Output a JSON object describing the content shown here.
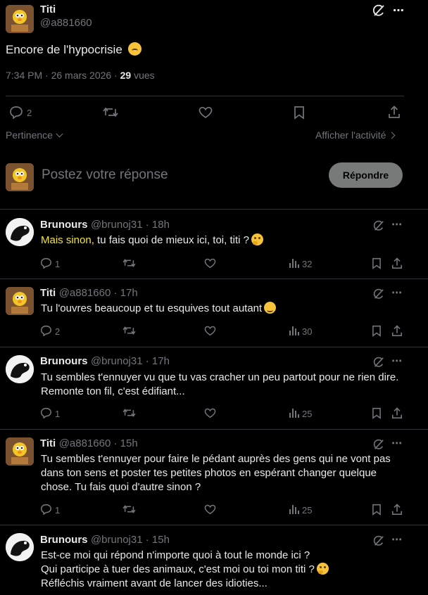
{
  "main_post": {
    "author_name": "Titi",
    "author_handle": "@a881660",
    "text": "Encore de l'hypocrisie",
    "timestamp": "7:34 PM · 26 mars 2026 · ",
    "views_count": "29",
    "views_label": " vues",
    "reply_count": "2"
  },
  "sort": {
    "label": "Pertinence",
    "activity_label": "Afficher l'activité"
  },
  "composer": {
    "placeholder": "Postez votre réponse",
    "button_label": "Répondre"
  },
  "replies": [
    {
      "author_name": "Brunours",
      "author_handle": "@brunoj31 · 18h",
      "text_highlight": "Mais sinon,",
      "text": " tu fais quoi de mieux ici, toi, titi ?",
      "replies": "1",
      "views": "32"
    },
    {
      "author_name": "Titi",
      "author_handle": "@a881660 · 17h",
      "text": "Tu l'ouvres beaucoup et tu esquives tout autant",
      "replies": "2",
      "views": "30"
    },
    {
      "author_name": "Brunours",
      "author_handle": "@brunoj31 · 17h",
      "text": "Tu sembles t'ennuyer vu que tu vas cracher un peu partout pour ne rien dire. Remonte ton fil, c'est édifiant...",
      "replies": "1",
      "views": "25"
    },
    {
      "author_name": "Titi",
      "author_handle": "@a881660 · 15h",
      "text": "Tu sembles t'ennuyer pour faire  le pédant auprès des gens qui ne vont pas dans ton sens et poster tes petites photos en espérant changer quelque chose. Tu fais quoi d'autre sinon ?",
      "replies": "1",
      "views": "25"
    },
    {
      "author_name": "Brunours",
      "author_handle": "@brunoj31 · 15h",
      "text_line1": "Est-ce moi qui répond n'importe quoi à tout le monde ici ?",
      "text_line2": "Qui participe à tuer des animaux, c'est moi ou toi mon titi ?",
      "text_line3": "Réfléchis vraiment avant de lancer des idioties..."
    }
  ],
  "colors": {
    "background": "#000000",
    "text": "#e7e9ea",
    "muted": "#71767b",
    "divider": "#2f3336",
    "highlight": "#f5e52b",
    "reply_button_bg": "#787a7a"
  }
}
